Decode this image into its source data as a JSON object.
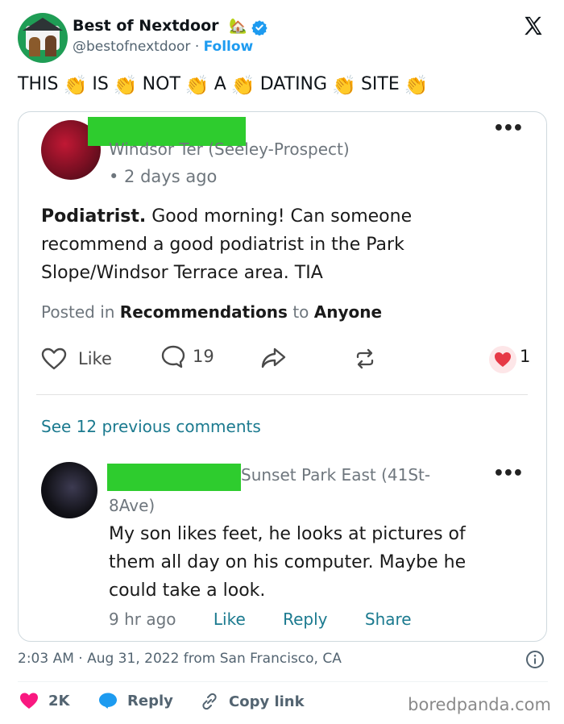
{
  "account": {
    "name": "Best of Nextdoor",
    "name_emoji": "🏡",
    "handle": "@bestofnextdoor",
    "separator": "·",
    "follow_label": "Follow"
  },
  "tweet": {
    "words": [
      "THIS",
      "IS",
      "NOT",
      "A",
      "DATING",
      "SITE"
    ],
    "clap": "👏"
  },
  "post": {
    "location": "Windsor Ter (Seeley-Prospect)",
    "time": "• 2 days ago",
    "subject": "Podiatrist.",
    "body": "Good morning! Can someone recommend a good podiatrist in the Park Slope/Windsor Terrace area. TIA",
    "posted_in_prefix": "Posted in",
    "category": "Recommendations",
    "to_prefix": "to",
    "audience": "Anyone",
    "like_label": "Like",
    "comment_count": "19",
    "reaction_count": "1",
    "more": "•••"
  },
  "comments": {
    "previous_label": "See 12 previous comments",
    "location_line1": "Sunset Park East (41St-",
    "location_line2": "8Ave)",
    "body": "My son likes feet, he looks at pictures of them all day on his computer. Maybe he could take a look.",
    "time": "9 hr ago",
    "like_label": "Like",
    "reply_label": "Reply",
    "share_label": "Share",
    "more": "•••"
  },
  "meta": {
    "timestamp": "2:03 AM · Aug 31, 2022 from San Francisco, CA"
  },
  "footer": {
    "likes": "2K",
    "reply": "Reply",
    "copy_link": "Copy link",
    "watermark": "boredpanda.com"
  },
  "colors": {
    "verified": "#1d9bf0",
    "redaction": "#2ecc2e",
    "heart": "#f91880",
    "link_teal": "#1b7a8f"
  }
}
